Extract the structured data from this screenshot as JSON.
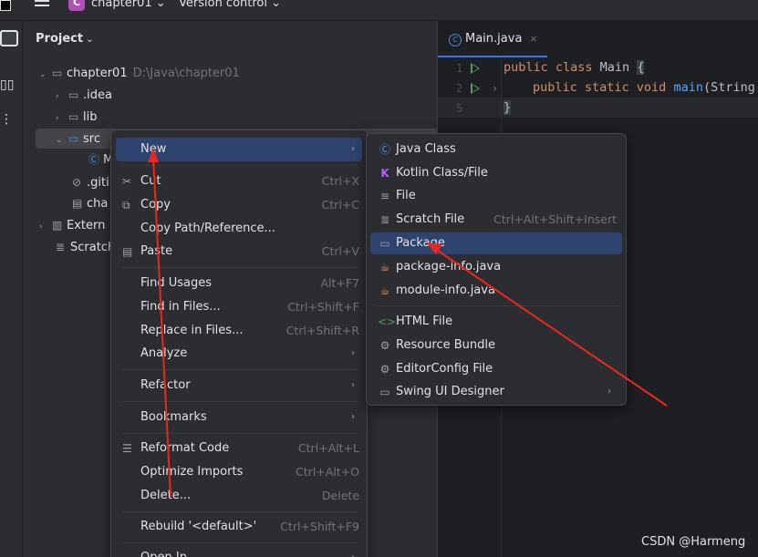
{
  "titlebar": {
    "project_badge": "C",
    "project_name": "chapter01 ⌄",
    "version_control": "Version control ⌄"
  },
  "project_panel": {
    "title": "Project",
    "tree": [
      {
        "label": "chapter01",
        "path": "D:\\Java\\chapter01",
        "icon": "folder-module-icon",
        "arrow": "⌄"
      },
      {
        "label": ".idea",
        "icon": "folder-icon",
        "arrow": "›"
      },
      {
        "label": "lib",
        "icon": "folder-icon",
        "arrow": "›"
      },
      {
        "label": "src",
        "icon": "folder-source-icon",
        "arrow": "⌄"
      },
      {
        "label": "M",
        "icon": "java-class-icon"
      },
      {
        "label": ".giti",
        "icon": "ignore-file-icon"
      },
      {
        "label": "cha",
        "icon": "iml-file-icon"
      },
      {
        "label": "Extern",
        "icon": "external-libraries-icon",
        "arrow": "›"
      },
      {
        "label": "Scratch",
        "icon": "scratches-icon"
      }
    ]
  },
  "editor": {
    "tab_label": "Main.java",
    "tab_icon": "C",
    "tab_close": "×",
    "line_numbers": [
      "1",
      "2",
      "5"
    ],
    "lines": [
      {
        "kw": "public class",
        "name": " Main ",
        "rest": "{"
      },
      {
        "kw": "public static void",
        "name": " main",
        "rest": "(String["
      },
      {
        "kw": "",
        "name": "",
        "rest": "}"
      }
    ]
  },
  "context_menu": {
    "items": [
      {
        "label": "New",
        "shortcut": "",
        "submenu": true,
        "active": true
      },
      {
        "label": "Cut",
        "shortcut": "Ctrl+X",
        "icon": "cut-icon",
        "glyph": "✂"
      },
      {
        "label": "Copy",
        "shortcut": "Ctrl+C",
        "icon": "copy-icon",
        "glyph": "⧉"
      },
      {
        "label": "Copy Path/Reference...",
        "shortcut": ""
      },
      {
        "label": "Paste",
        "shortcut": "Ctrl+V",
        "icon": "paste-icon",
        "glyph": "📋"
      },
      {
        "label": "Find Usages",
        "shortcut": "Alt+F7"
      },
      {
        "label": "Find in Files...",
        "shortcut": "Ctrl+Shift+F"
      },
      {
        "label": "Replace in Files...",
        "shortcut": "Ctrl+Shift+R"
      },
      {
        "label": "Analyze",
        "shortcut": "",
        "submenu": true
      },
      {
        "label": "Refactor",
        "shortcut": "",
        "submenu": true
      },
      {
        "label": "Bookmarks",
        "shortcut": "",
        "submenu": true
      },
      {
        "label": "Reformat Code",
        "shortcut": "Ctrl+Alt+L",
        "icon": "reformat-icon",
        "glyph": "☰"
      },
      {
        "label": "Optimize Imports",
        "shortcut": "Ctrl+Alt+O"
      },
      {
        "label": "Delete...",
        "shortcut": "Delete"
      },
      {
        "label": "Rebuild '<default>'",
        "shortcut": "Ctrl+Shift+F9"
      },
      {
        "label": "Open In",
        "shortcut": "",
        "submenu": true
      }
    ]
  },
  "new_submenu": {
    "items": [
      {
        "label": "Java Class",
        "shortcut": "",
        "icon": "java-class-icon",
        "glyph": "Ⓒ"
      },
      {
        "label": "Kotlin Class/File",
        "shortcut": "",
        "icon": "kotlin-icon",
        "glyph": "K"
      },
      {
        "label": "File",
        "shortcut": "",
        "icon": "file-icon",
        "glyph": "≡"
      },
      {
        "label": "Scratch File",
        "shortcut": "Ctrl+Alt+Shift+Insert",
        "icon": "scratch-file-icon",
        "glyph": "≣"
      },
      {
        "label": "Package",
        "shortcut": "",
        "icon": "package-icon",
        "glyph": "▭",
        "active": true
      },
      {
        "label": "package-info.java",
        "shortcut": "",
        "icon": "java-file-icon",
        "glyph": "☕"
      },
      {
        "label": "module-info.java",
        "shortcut": "",
        "icon": "java-file-icon",
        "glyph": "☕"
      },
      {
        "label": "HTML File",
        "shortcut": "",
        "icon": "html-icon",
        "glyph": "<>"
      },
      {
        "label": "Resource Bundle",
        "shortcut": "",
        "icon": "resource-bundle-icon",
        "glyph": "⚙"
      },
      {
        "label": "EditorConfig File",
        "shortcut": "",
        "icon": "editorconfig-icon",
        "glyph": "⚙"
      },
      {
        "label": "Swing UI Designer",
        "shortcut": "",
        "icon": "swing-icon",
        "glyph": "▭",
        "submenu": true
      }
    ]
  },
  "submenu_arrow": "›",
  "watermark": "CSDN @Harmeng",
  "colors": {
    "accent": "#3574f0",
    "selection": "#2e436e",
    "annotation_arrow": "#e8281f"
  }
}
